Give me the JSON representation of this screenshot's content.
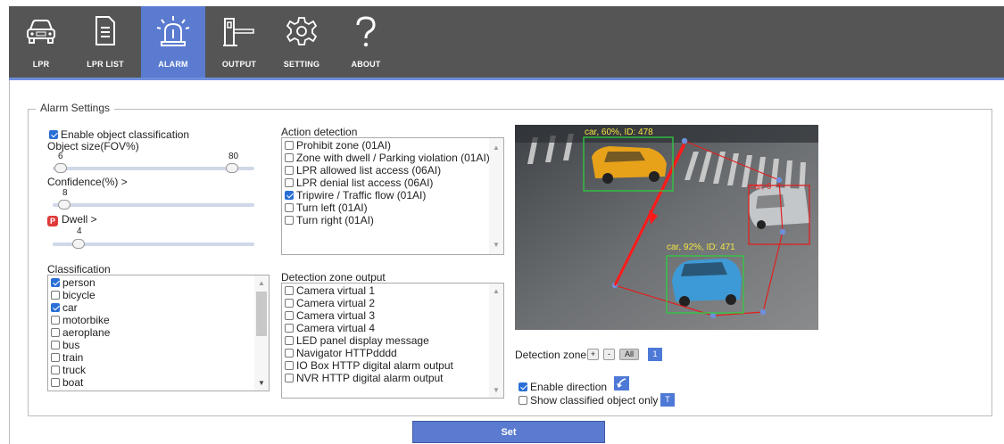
{
  "nav": [
    {
      "label": "LPR",
      "icon": "car-icon",
      "active": false
    },
    {
      "label": "LPR LIST",
      "icon": "document-icon",
      "active": false
    },
    {
      "label": "ALARM",
      "icon": "alarm-light-icon",
      "active": true
    },
    {
      "label": "OUTPUT",
      "icon": "barrier-gate-icon",
      "active": false
    },
    {
      "label": "SETTING",
      "icon": "gear-icon",
      "active": false
    },
    {
      "label": "ABOUT",
      "icon": "question-icon",
      "active": false
    }
  ],
  "colors": {
    "nav_bg": "#555555",
    "nav_active": "#5b7bd0",
    "accent": "#4e79d6",
    "zone": "#e02020",
    "box_green": "#2ecc40",
    "label_yellow": "#f5e642"
  },
  "section_title": "Alarm Settings",
  "left": {
    "enable_classification": {
      "label": "Enable object classification",
      "checked": true
    },
    "object_size": {
      "label": "Object size(FOV%)",
      "min_value": "6",
      "max_value": "80"
    },
    "confidence": {
      "label": "Confidence(%) >",
      "value": "8"
    },
    "dwell": {
      "label": "Dwell >",
      "value": "4"
    },
    "classification_label": "Classification",
    "classification": [
      {
        "label": "person",
        "checked": true
      },
      {
        "label": "bicycle",
        "checked": false
      },
      {
        "label": "car",
        "checked": true
      },
      {
        "label": "motorbike",
        "checked": false
      },
      {
        "label": "aeroplane",
        "checked": false
      },
      {
        "label": "bus",
        "checked": false
      },
      {
        "label": "train",
        "checked": false
      },
      {
        "label": "truck",
        "checked": false
      },
      {
        "label": "boat",
        "checked": false
      }
    ]
  },
  "action": {
    "label": "Action detection",
    "items": [
      {
        "label": "Prohibit zone (01AI)",
        "checked": false
      },
      {
        "label": "Zone with dwell / Parking violation (01AI)",
        "checked": false
      },
      {
        "label": "LPR allowed list access (06AI)",
        "checked": false
      },
      {
        "label": "LPR denial list access (06AI)",
        "checked": false
      },
      {
        "label": "Tripwire / Traffic flow (01AI)",
        "checked": true
      },
      {
        "label": "Turn left (01AI)",
        "checked": false
      },
      {
        "label": "Turn right (01AI)",
        "checked": false
      }
    ]
  },
  "zone_output": {
    "label": "Detection zone output",
    "items": [
      {
        "label": "Camera virtual 1",
        "checked": false
      },
      {
        "label": "Camera virtual 2",
        "checked": false
      },
      {
        "label": "Camera virtual 3",
        "checked": false
      },
      {
        "label": "Camera virtual 4",
        "checked": false
      },
      {
        "label": "LED panel display message",
        "checked": false
      },
      {
        "label": "Navigator HTTPdddd",
        "checked": false
      },
      {
        "label": "IO Box HTTP digital alarm output",
        "checked": false
      },
      {
        "label": "NVR HTTP digital alarm output",
        "checked": false
      }
    ]
  },
  "video": {
    "detections": [
      {
        "label": "car, 60%, ID: 478"
      },
      {
        "label": "car, 92%, ID: 471"
      },
      {
        "label": "car, 6"
      }
    ]
  },
  "detection_zone": {
    "label": "Detection zone",
    "plus": "+",
    "minus": "-",
    "all": "All",
    "index": "1"
  },
  "enable_direction": {
    "label": "Enable direction",
    "checked": true
  },
  "show_classified": {
    "label": "Show classified object only",
    "checked": false,
    "button": "T"
  },
  "set_button": "Set"
}
